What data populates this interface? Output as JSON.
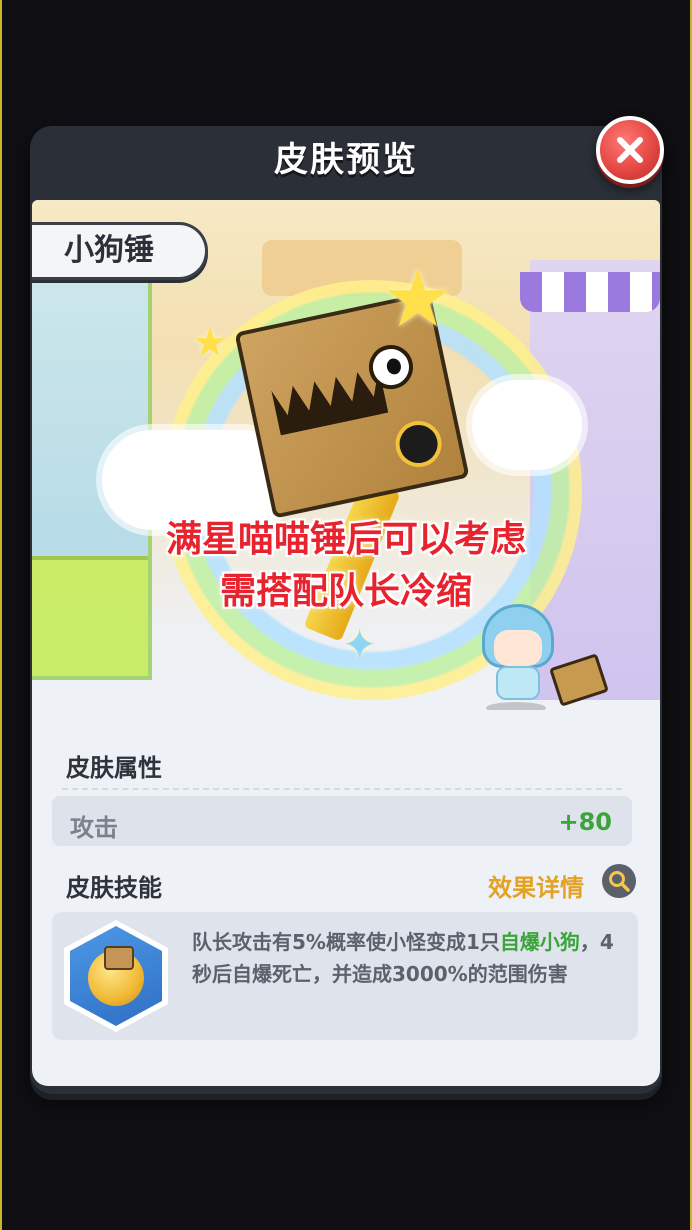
{
  "dialog": {
    "title": "皮肤预览",
    "close_icon": "close-icon"
  },
  "preview": {
    "skin_name": "小狗锤",
    "overlay_line1": "满星喵喵锤后可以考虑",
    "overlay_line2": "需搭配队长冷缩"
  },
  "attributes": {
    "section_title": "皮肤属性",
    "rows": [
      {
        "label": "攻击",
        "value": "+80"
      }
    ]
  },
  "skill": {
    "section_title": "皮肤技能",
    "detail_link": "效果详情",
    "description_before": "队长攻击有5%概率使小怪变成1只",
    "description_highlight": "自爆小狗",
    "description_after": "，4秒后自爆死亡，并造成3000%的范围伤害",
    "highlight_color": "#3ba43a"
  },
  "colors": {
    "accent_red": "#e8232e",
    "value_green": "#3ba43a",
    "link_gold": "#e3a224"
  }
}
